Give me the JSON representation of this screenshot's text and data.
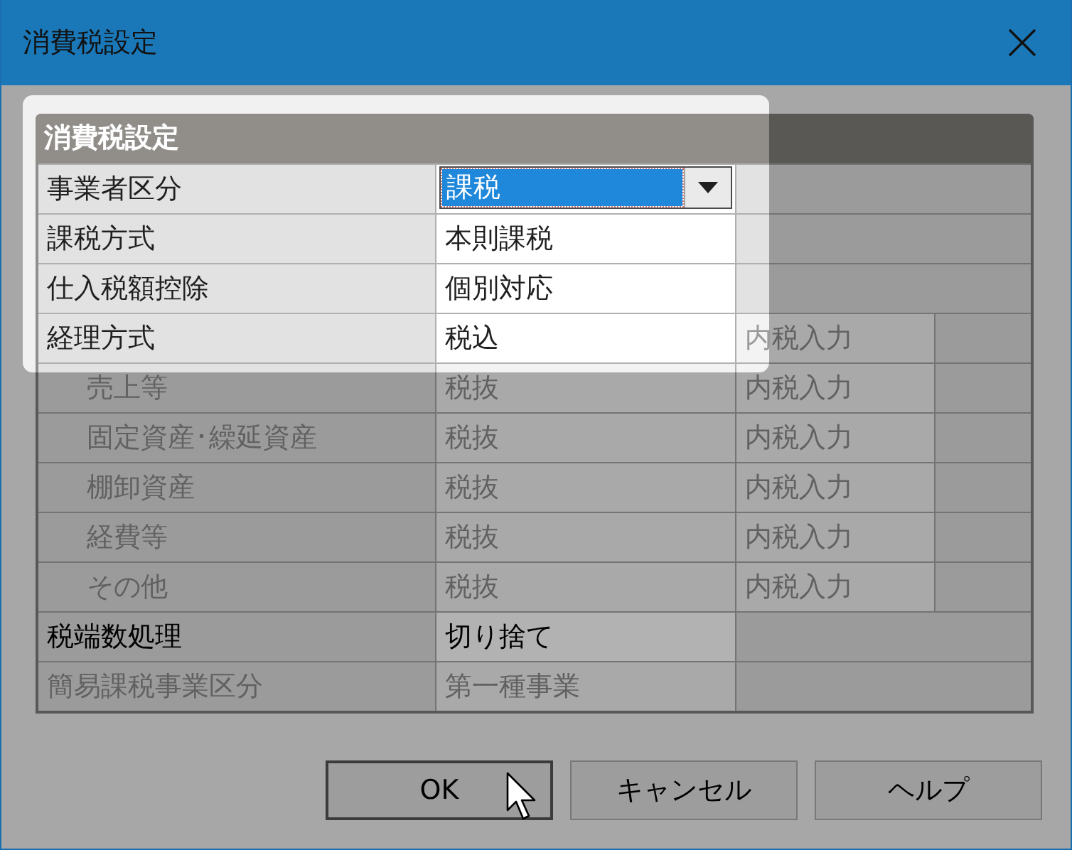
{
  "window": {
    "title": "消費税設定"
  },
  "table": {
    "title": "消費税設定",
    "rows": [
      {
        "kind": "dropdown",
        "label": "事業者区分",
        "value": "課税",
        "focused": true,
        "disabled": false
      },
      {
        "kind": "text",
        "label": "課税方式",
        "value": "本則課税",
        "disabled": false
      },
      {
        "kind": "text",
        "label": "仕入税額控除",
        "value": "個別対応",
        "disabled": false
      },
      {
        "kind": "text",
        "label": "経理方式",
        "value": "税込",
        "column_3": {
          "text": "内税入力",
          "disabled": true
        },
        "disabled": false,
        "children": [
          {
            "kind": "text",
            "label": "売上等",
            "value": "税抜",
            "column_3": {
              "text": "内税入力",
              "disabled": true
            },
            "disabled": true
          },
          {
            "kind": "text",
            "label": "固定資産･繰延資産",
            "value": "税抜",
            "column_3": {
              "text": "内税入力",
              "disabled": true
            },
            "disabled": true
          },
          {
            "kind": "text",
            "label": "棚卸資産",
            "value": "税抜",
            "column_3": {
              "text": "内税入力",
              "disabled": true
            },
            "disabled": true
          },
          {
            "kind": "text",
            "label": "経費等",
            "value": "税抜",
            "column_3": {
              "text": "内税入力",
              "disabled": true
            },
            "disabled": true
          },
          {
            "kind": "text",
            "label": "その他",
            "value": "税抜",
            "column_3": {
              "text": "内税入力",
              "disabled": true
            },
            "disabled": true
          }
        ]
      },
      {
        "kind": "text",
        "label": "税端数処理",
        "value": "切り捨て",
        "disabled": false
      },
      {
        "kind": "text",
        "label": "簡易課税事業区分",
        "value": "第一種事業",
        "disabled": true
      }
    ]
  },
  "buttons": [
    {
      "label": "OK",
      "default": true
    },
    {
      "label": "キャンセル",
      "default": false
    },
    {
      "label": "ヘルプ",
      "default": false
    }
  ]
}
